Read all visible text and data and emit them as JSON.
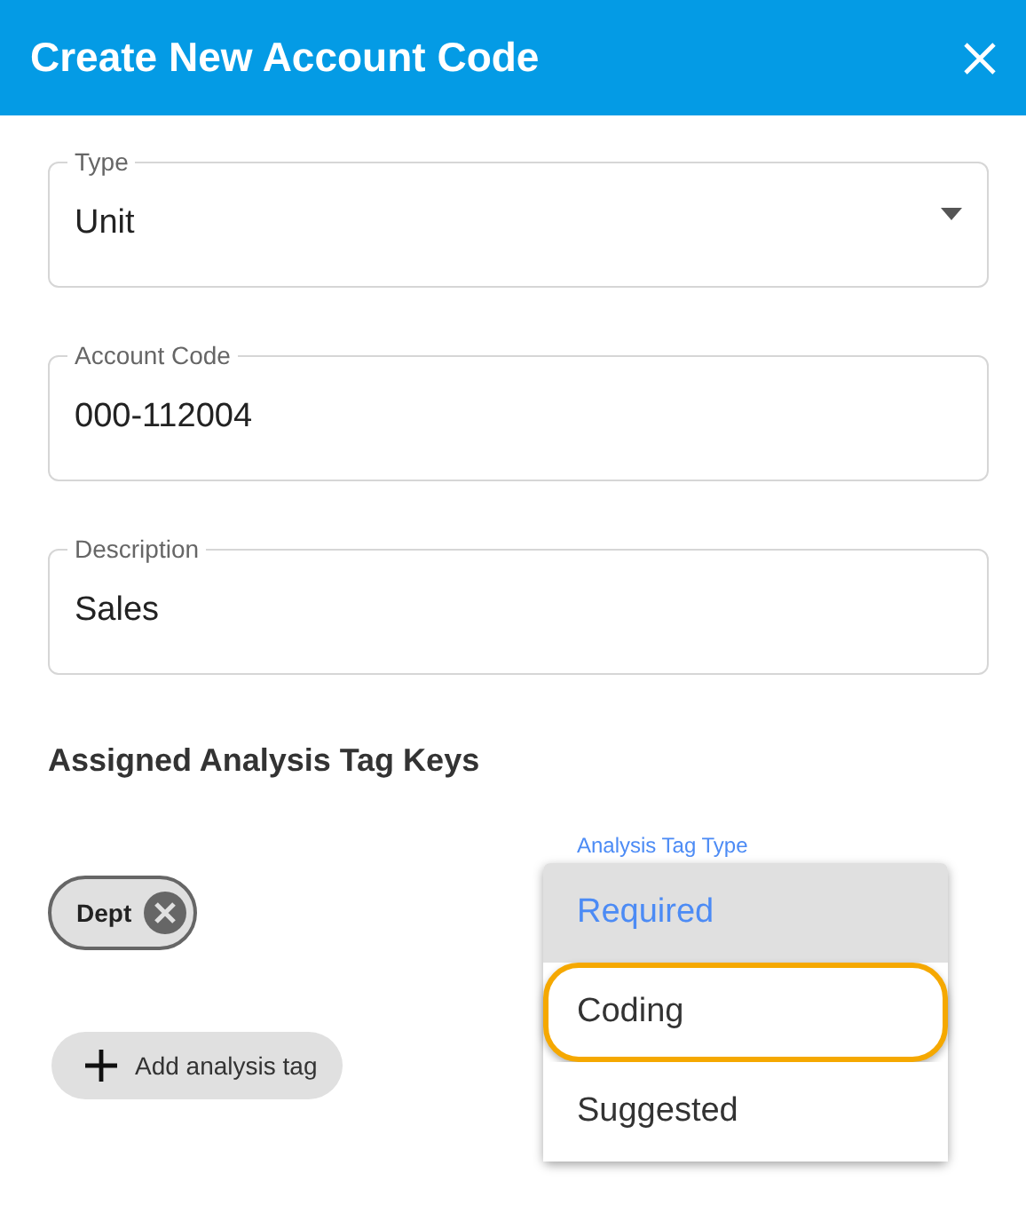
{
  "dialog": {
    "title": "Create New Account Code"
  },
  "fields": [
    {
      "kind": "select",
      "label": "Type",
      "value": "Unit"
    },
    {
      "kind": "text",
      "label": "Account Code",
      "value": "000-112004"
    },
    {
      "kind": "text",
      "label": "Description",
      "value": "Sales"
    }
  ],
  "section": {
    "heading": "Assigned Analysis Tag Keys"
  },
  "tags": [
    {
      "label": "Dept"
    }
  ],
  "add_button": {
    "label": "Add analysis tag"
  },
  "tag_type": {
    "label": "Analysis Tag Type",
    "options": [
      {
        "label": "Required",
        "selected": true,
        "focused": false
      },
      {
        "label": "Coding",
        "selected": false,
        "focused": true
      },
      {
        "label": "Suggested",
        "selected": false,
        "focused": false
      }
    ]
  }
}
